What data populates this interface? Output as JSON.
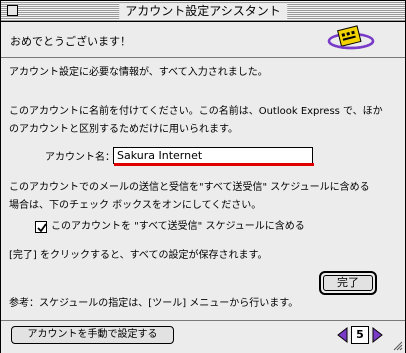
{
  "window": {
    "title": "アカウント設定アシスタント"
  },
  "header": {
    "title": "おめでとうございます！"
  },
  "content": {
    "intro": "アカウント設定に必要な情報が、すべて入力されました。",
    "naming_line1": "このアカウントに名前を付けてください。この名前は、Outlook Express で、ほか",
    "naming_line2": "のアカウントと区別するためだけに用いられます。",
    "account_name_label": "アカウント名：",
    "account_name_value": "Sakura Internet",
    "schedule_line1": "このアカウントでのメールの送信と受信を\"すべて送受信\" スケジュールに含める",
    "schedule_line2": "場合は、下のチェック ボックスをオンにしてください。",
    "checkbox_label": "このアカウントを \"すべて送受信\" スケジュールに含める",
    "checkbox_checked": true,
    "save_note": "[完了] をクリックすると、すべての設定が保存されます。",
    "done_button": "完了",
    "reference_note": "参考：スケジュールの指定は、[ツール] メニューから行います。"
  },
  "footer": {
    "manual_button": "アカウントを手動で設定する",
    "page_number": "5"
  },
  "colors": {
    "underline": "#e00000",
    "accent_purple": "#7a3cc8",
    "logo_yellow": "#f2d200"
  }
}
